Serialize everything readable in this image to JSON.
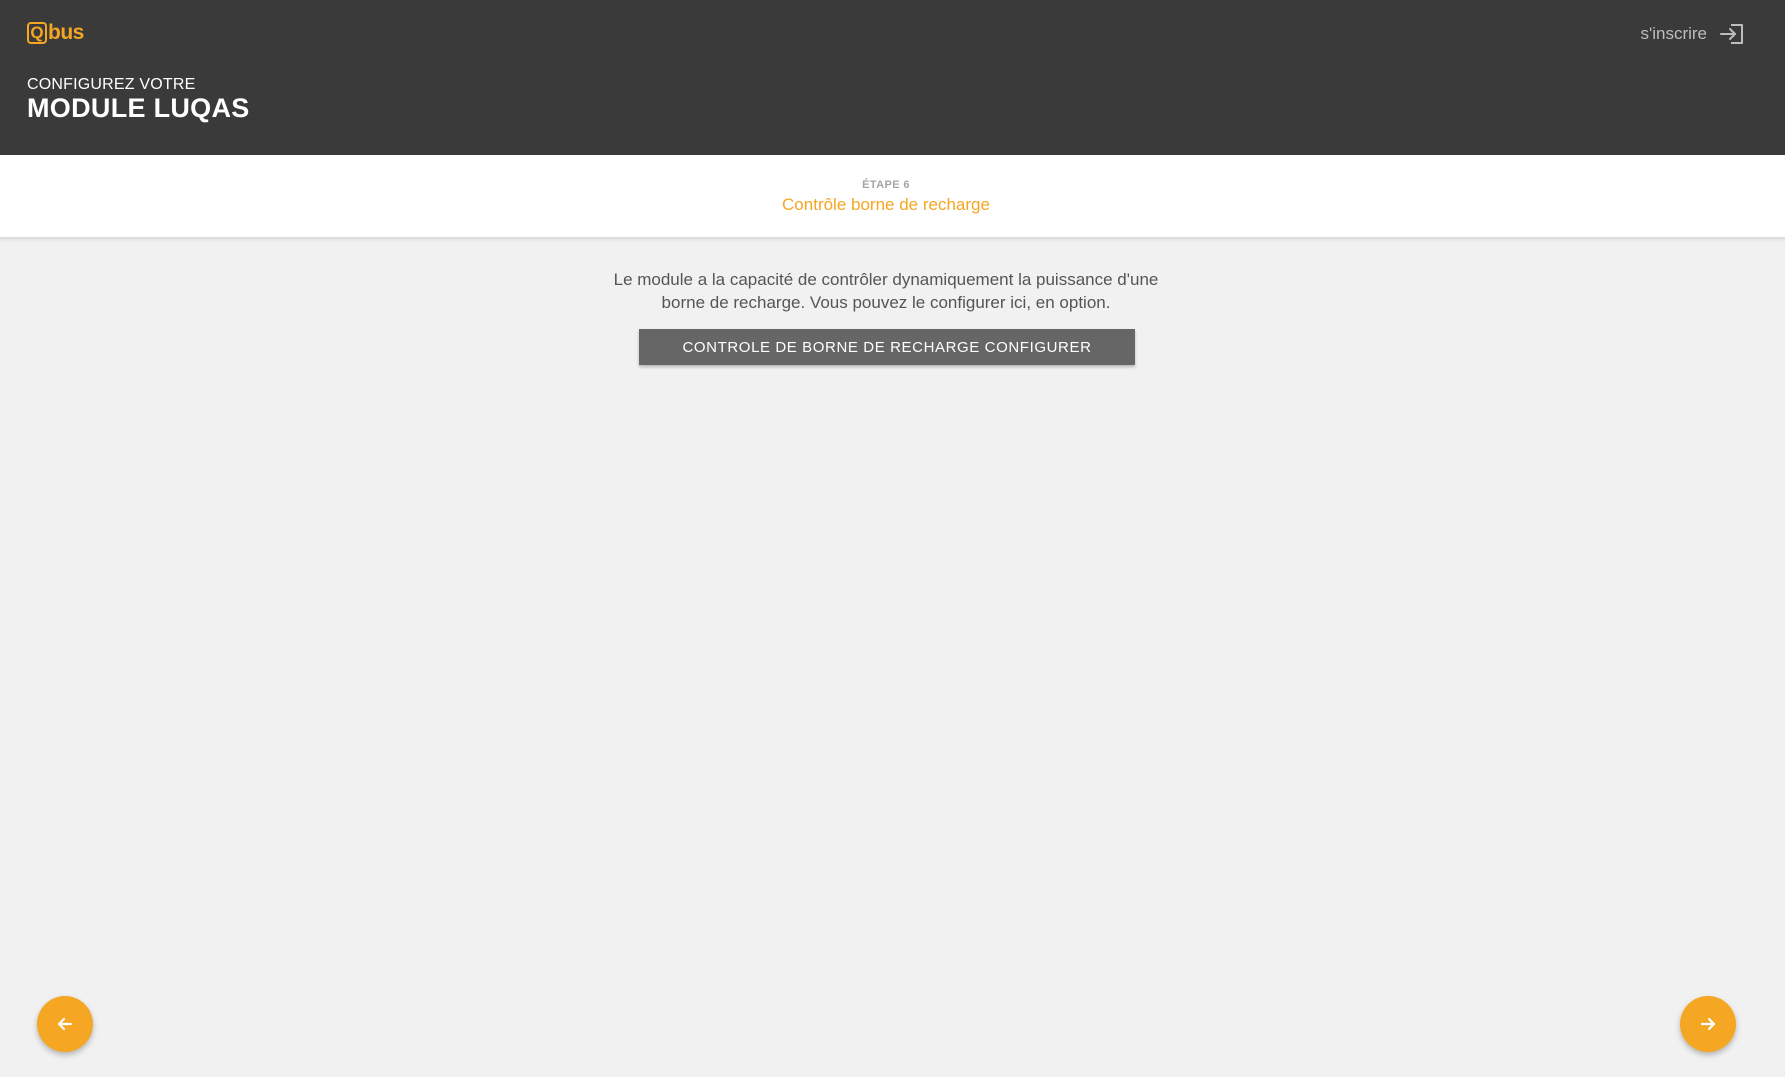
{
  "brand": {
    "logo_letter": "Q",
    "logo_text": "bus",
    "accent_color": "#f5a623"
  },
  "header": {
    "signin_label": "s'inscrire",
    "signin_icon": "sign-in-icon",
    "subtitle": "CONFIGUREZ VOTRE",
    "title": "MODULE LUQAS"
  },
  "step": {
    "number_label": "ÉTAPE 6",
    "title": "Contrôle borne de recharge"
  },
  "main": {
    "description": "Le module a la capacité de contrôler dynamiquement la puissance d'une borne de recharge. Vous pouvez le configurer ici, en option.",
    "configure_button_label": "CONTROLE DE BORNE DE RECHARGE CONFIGURER"
  },
  "navigation": {
    "previous_icon": "arrow-left-icon",
    "next_icon": "arrow-right-icon"
  },
  "colors": {
    "topbar": "#3a3a3a",
    "background": "#f1f1f1",
    "button": "#666666"
  }
}
